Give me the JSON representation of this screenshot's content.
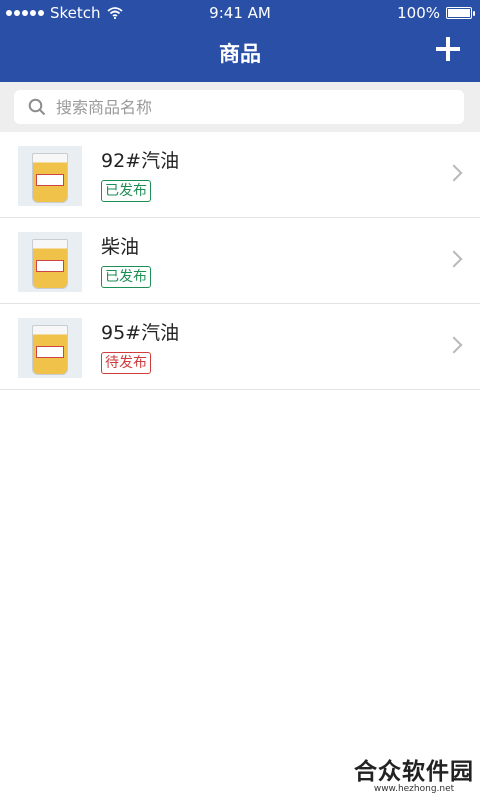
{
  "status": {
    "carrier": "Sketch",
    "time": "9:41 AM",
    "battery": "100%"
  },
  "header": {
    "title": "商品"
  },
  "search": {
    "placeholder": "搜索商品名称"
  },
  "items": [
    {
      "name": "92#汽油",
      "status": "已发布",
      "status_type": "published"
    },
    {
      "name": "柴油",
      "status": "已发布",
      "status_type": "published"
    },
    {
      "name": "95#汽油",
      "status": "待发布",
      "status_type": "pending"
    }
  ],
  "watermark": {
    "title": "合众软件园",
    "url": "www.hezhong.net"
  },
  "colors": {
    "header": "#2a4fa7",
    "published": "#1e8e55",
    "pending": "#d03b3b"
  }
}
